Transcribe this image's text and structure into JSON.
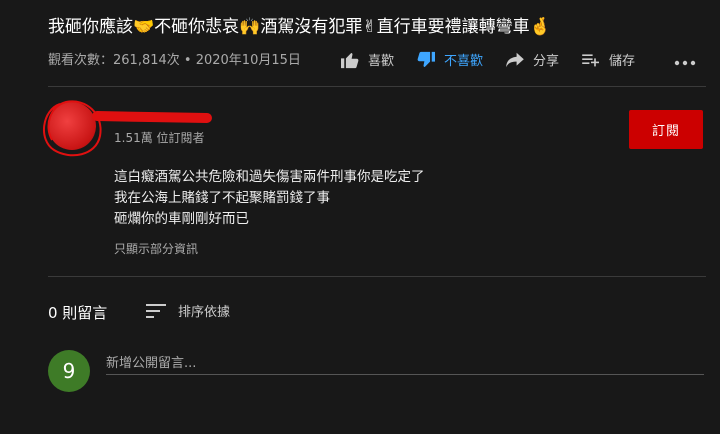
{
  "video": {
    "title": "我砸你應該🤝不砸你悲哀🙌酒駕沒有犯罪✌直行車要禮讓轉彎車🤞",
    "views": "觀看次數：261,814次",
    "separator": "•",
    "date": "2020年10月15日"
  },
  "actions": {
    "like": {
      "label": "喜歡",
      "icon": "thumbs-up-icon"
    },
    "dislike": {
      "label": "不喜歡",
      "icon": "thumbs-down-icon",
      "active": true,
      "color": "#3ea6ff"
    },
    "share": {
      "label": "分享",
      "icon": "share-arrow-icon"
    },
    "save": {
      "label": "儲存",
      "icon": "playlist-add-icon"
    },
    "more": {
      "label": "•••",
      "icon": "more-dots-icon"
    }
  },
  "channel": {
    "subscribers": "1.51萬 位訂閱者",
    "subscribe_label": "訂閱",
    "subscribe_color": "#cc0000",
    "avatar_color": "#d01a1a"
  },
  "description": {
    "lines": [
      "這白癡酒駕公共危險和過失傷害兩件刑事你是吃定了",
      "我在公海上賭錢了不起聚賭罰錢了事",
      "砸爛你的車剛剛好而已"
    ],
    "show_less": "只顯示部分資訊"
  },
  "comments": {
    "count_label": "0 則留言",
    "sort_label": "排序依據",
    "sort_icon": "sort-lines-icon",
    "user_avatar_letter": "9",
    "user_avatar_color": "#3e7b27",
    "input_placeholder": "新增公開留言..."
  },
  "colors": {
    "background": "#181818",
    "accent": "#3ea6ff"
  }
}
